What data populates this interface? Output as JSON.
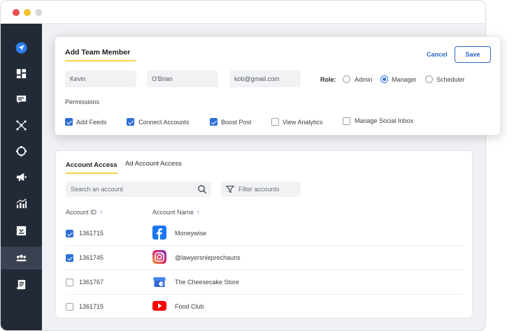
{
  "window": {
    "controls": [
      "close",
      "minimize",
      "zoom"
    ]
  },
  "sidebar": {
    "items": [
      {
        "icon": "send-icon",
        "active": false
      },
      {
        "icon": "dashboard-icon",
        "active": false
      },
      {
        "icon": "feed-icon",
        "active": false
      },
      {
        "icon": "network-icon",
        "active": false
      },
      {
        "icon": "compass-icon",
        "active": false
      },
      {
        "icon": "megaphone-icon",
        "active": false
      },
      {
        "icon": "analytics-icon",
        "active": false
      },
      {
        "icon": "inbox-icon",
        "active": false
      },
      {
        "icon": "team-icon",
        "active": true
      },
      {
        "icon": "reports-icon",
        "active": false
      }
    ]
  },
  "add_member": {
    "title": "Add Team Member",
    "cancel_label": "Cancel",
    "save_label": "Save",
    "first_name": "Kevin",
    "last_name": "O'Brian",
    "email": "kob@gmail.com",
    "role_label": "Role:",
    "roles": [
      {
        "label": "Admin",
        "selected": false
      },
      {
        "label": "Manager",
        "selected": true
      },
      {
        "label": "Scheduler",
        "selected": false
      }
    ],
    "permissions_title": "Permissions",
    "permissions": [
      {
        "label": "Add Feeds",
        "checked": true
      },
      {
        "label": "Connect Accounts",
        "checked": true
      },
      {
        "label": "Boost Post",
        "checked": true
      },
      {
        "label": "View Analytics",
        "checked": false
      },
      {
        "label": "Manage Social Inbox",
        "checked": false
      }
    ]
  },
  "access": {
    "tabs": [
      {
        "label": "Account Access",
        "active": true
      },
      {
        "label": "Ad Account Access",
        "active": false
      }
    ],
    "search_placeholder": "Search an account",
    "filter_label": "Filter accounts",
    "columns": [
      {
        "label": "Account ID",
        "sort": "↑"
      },
      {
        "label": "Account Name",
        "sort": "↑"
      }
    ],
    "rows": [
      {
        "id": "1361715",
        "name": "Moneywise",
        "network": "facebook",
        "checked": true
      },
      {
        "id": "1361745",
        "name": "@lawyersnleprechauns",
        "network": "instagram",
        "checked": true
      },
      {
        "id": "1361767",
        "name": "The Cheesecake Store",
        "network": "google-business",
        "checked": false
      },
      {
        "id": "1361715",
        "name": "Food Club",
        "network": "youtube",
        "checked": false
      }
    ]
  },
  "colors": {
    "sidebar_bg": "#222a38",
    "accent_blue": "#2b66c9",
    "highlight_yellow": "#f2d24a",
    "send_icon_blue": "#2d7ff0"
  }
}
